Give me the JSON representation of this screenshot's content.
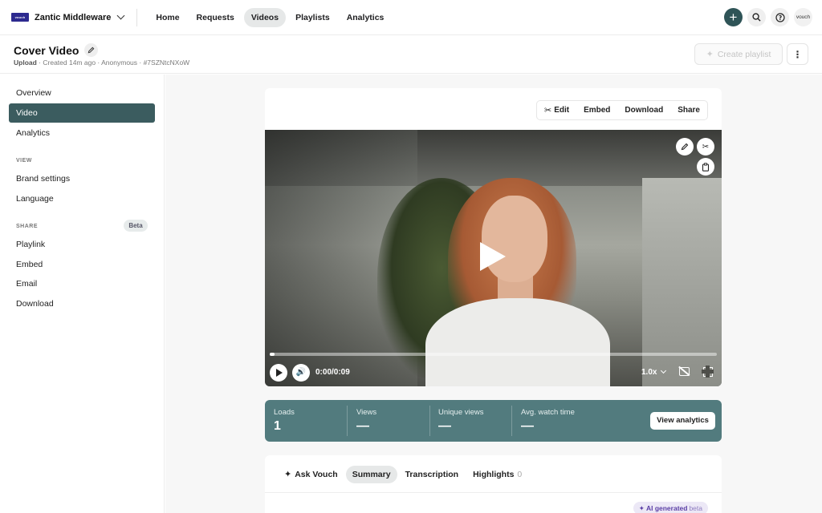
{
  "brand": {
    "logo_text": "vouch",
    "name": "Zantic Middleware"
  },
  "nav": {
    "items": [
      {
        "label": "Home",
        "active": false
      },
      {
        "label": "Requests",
        "active": false
      },
      {
        "label": "Videos",
        "active": true
      },
      {
        "label": "Playlists",
        "active": false
      },
      {
        "label": "Analytics",
        "active": false
      }
    ]
  },
  "topbar": {
    "avatar_label": "vouch"
  },
  "page": {
    "title": "Cover Video",
    "meta_type": "Upload",
    "meta_rest": " · Created 14m ago · Anonymous · #7SZNtcNXoW",
    "create_playlist": "Create playlist"
  },
  "sidebar": {
    "items": [
      {
        "label": "Overview",
        "active": false
      },
      {
        "label": "Video",
        "active": true
      },
      {
        "label": "Analytics",
        "active": false
      }
    ],
    "view_section": "VIEW",
    "view_items": [
      {
        "label": "Brand settings"
      },
      {
        "label": "Language"
      }
    ],
    "share_section": "SHARE",
    "share_badge": "Beta",
    "share_items": [
      {
        "label": "Playlink"
      },
      {
        "label": "Embed"
      },
      {
        "label": "Email"
      },
      {
        "label": "Download"
      }
    ]
  },
  "video_toolbar": {
    "edit": "Edit",
    "embed": "Embed",
    "download": "Download",
    "share": "Share"
  },
  "player": {
    "time": "0:00/0:09",
    "speed": "1.0x",
    "progress": 0.0
  },
  "stats": {
    "items": [
      {
        "label": "Loads",
        "value": "1"
      },
      {
        "label": "Views",
        "value": "—"
      },
      {
        "label": "Unique views",
        "value": "—"
      },
      {
        "label": "Avg. watch time",
        "value": "—"
      }
    ],
    "button": "View analytics"
  },
  "tabs": {
    "ask": "Ask Vouch",
    "summary": "Summary",
    "transcription": "Transcription",
    "highlights": "Highlights",
    "highlights_count": "0",
    "ai_label": "AI generated",
    "ai_beta": "beta"
  },
  "colors": {
    "accent": "#2f5457",
    "sidebar_active": "#3b5c5f",
    "stats_bg": "#527b7e",
    "ai_pill": "#ece8f6"
  }
}
